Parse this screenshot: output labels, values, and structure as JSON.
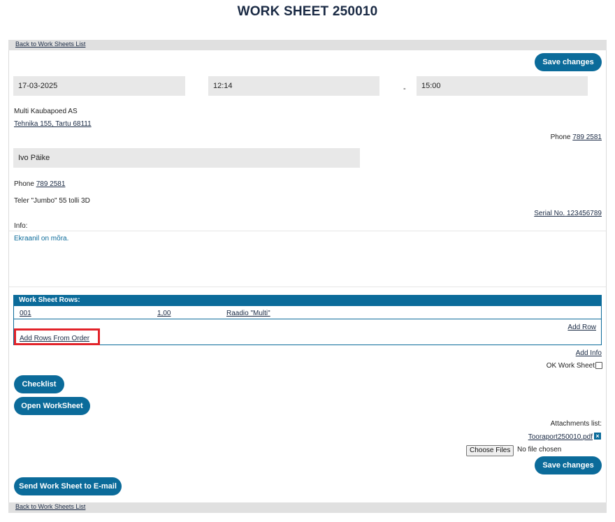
{
  "page_title": "WORK SHEET 250010",
  "nav": {
    "back_label": "Back to Work Sheets List"
  },
  "buttons": {
    "save_changes": "Save changes",
    "checklist": "Checklist",
    "open_worksheet": "Open WorkSheet",
    "send_email": "Send Work Sheet to E-mail"
  },
  "schedule": {
    "date": "17-03-2025",
    "start_time": "12:14",
    "separator": "-",
    "end_time": "15:00"
  },
  "customer": {
    "company": "Multi Kaubapoed AS",
    "address": "Tehnika 155, Tartu 68111",
    "phone_label": "Phone",
    "phone": "789 2581"
  },
  "contact": {
    "name": "Ivo Päike",
    "phone_label": "Phone",
    "phone": "789 2581"
  },
  "device": {
    "name": "Teler \"Jumbo\" 55 tolli 3D",
    "serial_label": "Serial No.",
    "serial": "123456789"
  },
  "info": {
    "label": "Info:",
    "text": "Ekraanil on mõra."
  },
  "rows": {
    "header": "Work Sheet Rows:",
    "items": [
      {
        "code": "001",
        "qty": "1,00",
        "name": "Raadio \"Multi\""
      }
    ],
    "add_row": "Add Row",
    "add_from_order": "Add Rows From Order"
  },
  "extras": {
    "add_info": "Add Info",
    "ok_label": "OK Work Sheet"
  },
  "attachments": {
    "label": "Attachments list:",
    "files": [
      "Tooraport250010.pdf"
    ],
    "choose_files": "Choose Files",
    "no_file": "No file chosen",
    "delete_icon": "x-icon"
  },
  "colors": {
    "accent": "#0b6b9a",
    "highlight": "#e2232a",
    "field_bg": "#e8e8e8"
  }
}
